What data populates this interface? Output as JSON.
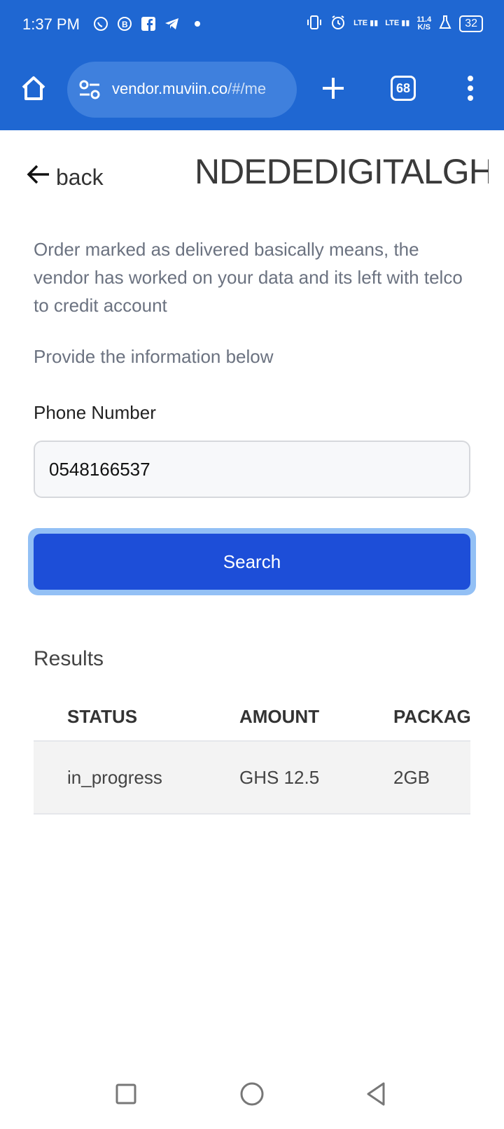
{
  "status_bar": {
    "time": "1:37 PM",
    "apps": [
      "whatsapp-icon",
      "business-icon",
      "facebook-icon",
      "telegram-icon"
    ],
    "network_1": "LTE",
    "network_2": "LTE",
    "speed_value": "11.4",
    "speed_unit": "K/S",
    "battery": "32"
  },
  "browser": {
    "url_main": "vendor.muviin.co",
    "url_rest": "/#/me",
    "tab_count": "68"
  },
  "page": {
    "back_label": "back",
    "brand": "NDEDEDIGITALGH",
    "note": "Order marked as delivered basically means, the vendor has worked on your data and its left with telco to credit account",
    "provide": "Provide the information below",
    "phone_label": "Phone Number",
    "phone_value": "0548166537",
    "search_label": "Search",
    "results_title": "Results"
  },
  "table": {
    "headers": [
      "STATUS",
      "AMOUNT",
      "PACKAG"
    ],
    "rows": [
      [
        "in_progress",
        "GHS 12.5",
        "2GB"
      ]
    ]
  },
  "colors": {
    "chrome": "#1f67d2",
    "button": "#1d4ed8",
    "status_in_progress": "#e0a61a"
  }
}
